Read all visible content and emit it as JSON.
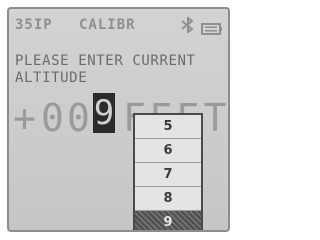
{
  "status_bar": {
    "record_number": "35IP",
    "mode": "CALIBR",
    "bluetooth_icon": "bluetooth-icon",
    "battery_icon": "battery-icon"
  },
  "prompt": "PLEASE ENTER CURRENT\nALTITUDE",
  "altitude": {
    "sign": "+",
    "digits": [
      "0",
      "0"
    ],
    "active_digit": "9",
    "unit": "FEET"
  },
  "digit_picker": {
    "options": [
      "5",
      "6",
      "7",
      "8",
      "9"
    ],
    "selected": "9"
  }
}
